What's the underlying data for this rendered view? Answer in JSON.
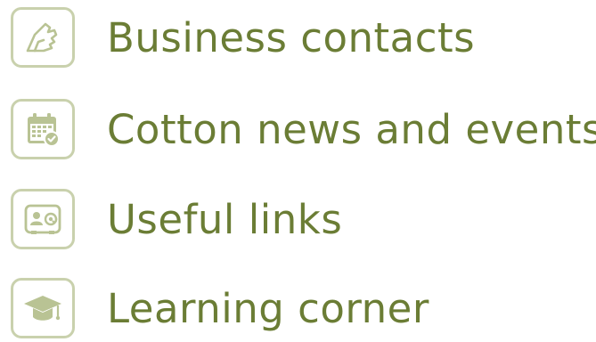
{
  "theme": {
    "text_color": "#6b7d35",
    "icon_color": "#b9c394",
    "icon_border": "#c9d1ad"
  },
  "menu": {
    "items": [
      {
        "label": "Business contacts",
        "icon": "handshake-icon"
      },
      {
        "label": "Cotton news and events",
        "icon": "calendar-check-icon"
      },
      {
        "label": "Useful links",
        "icon": "contact-card-at-icon"
      },
      {
        "label": "Learning corner",
        "icon": "graduation-cap-icon"
      }
    ]
  }
}
